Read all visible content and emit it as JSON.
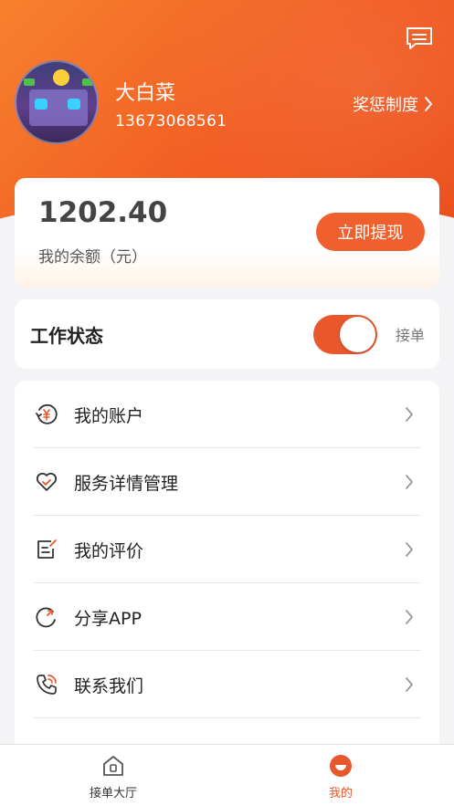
{
  "header": {
    "user_name": "大白菜",
    "phone": "13673068561",
    "rules_link": "奖惩制度",
    "message_icon": "message-icon",
    "avatar_icon": "avatar-game-image"
  },
  "balance": {
    "amount": "1202.40",
    "label": "我的余额（元）",
    "withdraw_button": "立即提现"
  },
  "work_status": {
    "title": "工作状态",
    "toggle_on": true,
    "status_text": "接单"
  },
  "menu": {
    "items": [
      {
        "label": "我的账户",
        "icon": "wallet-yen-icon"
      },
      {
        "label": "服务详情管理",
        "icon": "heart-icon"
      },
      {
        "label": "我的评价",
        "icon": "edit-note-icon"
      },
      {
        "label": "分享APP",
        "icon": "share-refresh-icon"
      },
      {
        "label": "联系我们",
        "icon": "phone-icon"
      }
    ]
  },
  "tabbar": {
    "tabs": [
      {
        "label": "接单大厅",
        "icon": "home-icon",
        "active": false
      },
      {
        "label": "我的",
        "icon": "profile-icon",
        "active": true
      }
    ]
  },
  "colors": {
    "accent": "#f0602f",
    "header_start": "#f7812e",
    "header_end": "#ea4f1c",
    "background": "#f4f4f6"
  }
}
